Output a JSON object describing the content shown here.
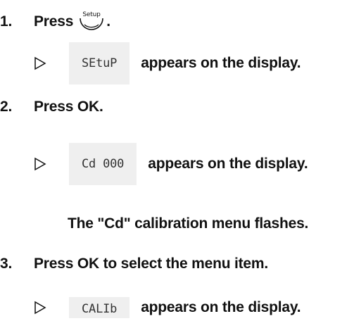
{
  "steps": [
    {
      "number": "1.",
      "text": "Press",
      "icon": "setup-button-icon",
      "icon_label": "Setup",
      "suffix": "."
    },
    {
      "number": "2.",
      "text": "Press OK."
    },
    {
      "number": "3.",
      "text": "Press OK to select the menu item."
    }
  ],
  "results": [
    {
      "display": "SEtuP",
      "text": "appears on the display."
    },
    {
      "display": "Cd 000",
      "text": "appears on the display."
    },
    {
      "display": "CALIb",
      "text": "appears on the display."
    }
  ],
  "note": "The \"Cd\" calibration menu flashes."
}
